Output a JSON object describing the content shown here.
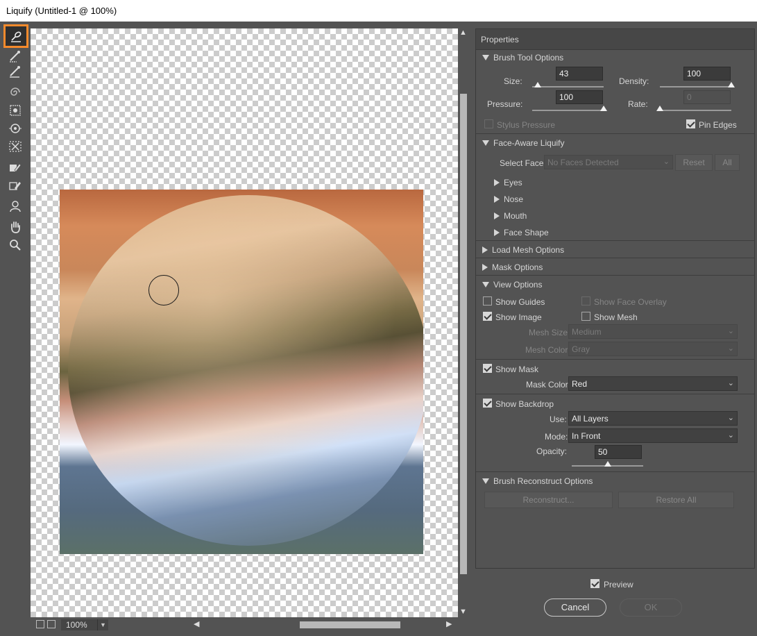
{
  "window": {
    "title": "Liquify (Untitled-1 @ 100%)"
  },
  "toolbar": {
    "tools": [
      {
        "name": "forward-warp-tool",
        "active": true
      },
      {
        "name": "reconstruct-tool"
      },
      {
        "name": "smooth-tool"
      },
      {
        "name": "twirl-clockwise-tool"
      },
      {
        "name": "pucker-tool"
      },
      {
        "name": "bloat-tool"
      },
      {
        "name": "push-left-tool"
      },
      {
        "name": "freeze-mask-tool"
      },
      {
        "name": "thaw-mask-tool"
      },
      {
        "name": "face-tool"
      },
      {
        "name": "hand-tool"
      },
      {
        "name": "zoom-tool"
      }
    ]
  },
  "statusbar": {
    "zoom": "100%"
  },
  "panel": {
    "title": "Properties",
    "brush_tool_options": {
      "heading": "Brush Tool Options",
      "size_label": "Size:",
      "size_value": "43",
      "size_level": 0.08,
      "density_label": "Density:",
      "density_value": "100",
      "density_level": 1.0,
      "pressure_label": "Pressure:",
      "pressure_value": "100",
      "pressure_level": 1.0,
      "rate_label": "Rate:",
      "rate_value": "0",
      "rate_level": 0.0,
      "stylus_pressure_label": "Stylus Pressure",
      "pin_edges_label": "Pin Edges"
    },
    "face_aware": {
      "heading": "Face-Aware Liquify",
      "select_face_label": "Select Face:",
      "select_face_value": "No Faces Detected",
      "reset_label": "Reset",
      "all_label": "All",
      "items": [
        "Eyes",
        "Nose",
        "Mouth",
        "Face Shape"
      ]
    },
    "load_mesh_heading": "Load Mesh Options",
    "mask_options_heading": "Mask Options",
    "view_options": {
      "heading": "View Options",
      "show_guides": "Show Guides",
      "show_face_overlay": "Show Face Overlay",
      "show_image": "Show Image",
      "show_mesh": "Show Mesh",
      "mesh_size_label": "Mesh Size:",
      "mesh_size_value": "Medium",
      "mesh_color_label": "Mesh Color:",
      "mesh_color_value": "Gray",
      "show_mask": "Show Mask",
      "mask_color_label": "Mask Color:",
      "mask_color_value": "Red",
      "show_backdrop": "Show Backdrop",
      "use_label": "Use:",
      "use_value": "All Layers",
      "mode_label": "Mode:",
      "mode_value": "In Front",
      "opacity_label": "Opacity:",
      "opacity_value": "50",
      "opacity_level": 0.5
    },
    "brush_reconstruct": {
      "heading": "Brush Reconstruct Options",
      "reconstruct_label": "Reconstruct...",
      "restore_all_label": "Restore All"
    }
  },
  "footer": {
    "preview_label": "Preview",
    "cancel_label": "Cancel",
    "ok_label": "OK"
  },
  "colors": {
    "accent": "#f58a2c",
    "panel_bg": "#535353"
  }
}
